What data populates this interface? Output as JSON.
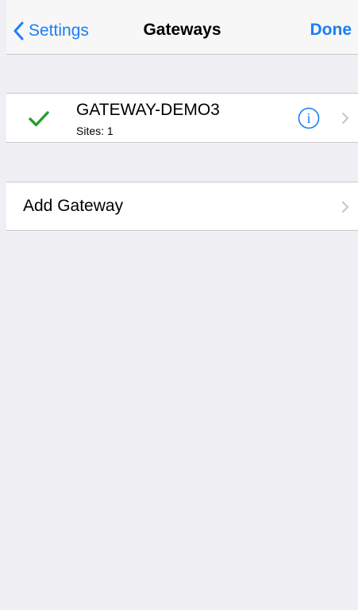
{
  "navbar": {
    "back_label": "Settings",
    "title": "Gateways",
    "done_label": "Done"
  },
  "gateways": [
    {
      "name": "GATEWAY-DEMO3",
      "sites": "Sites: 1",
      "selected": true,
      "icons": [
        "checkmark-icon",
        "info-icon",
        "chevron-right-icon"
      ]
    }
  ],
  "add_gateway": {
    "label": "Add Gateway"
  },
  "colors": {
    "accent": "#1a7ff5",
    "check": "#2a9a2f",
    "background": "#efeff4",
    "separator": "#c8c7cc",
    "chevron": "#c7c7cc"
  }
}
